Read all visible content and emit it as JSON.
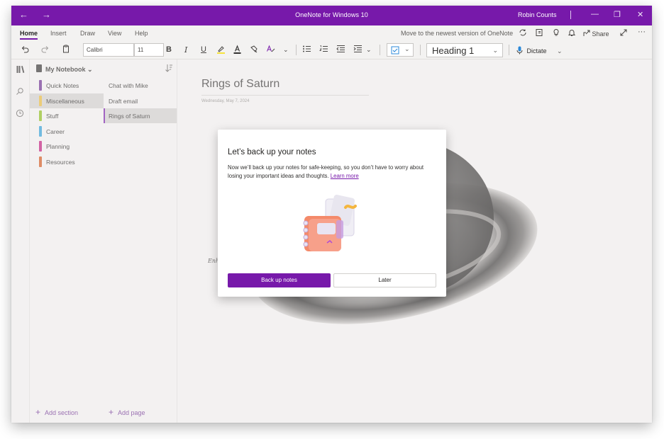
{
  "titlebar": {
    "title": "OneNote for Windows 10",
    "user": "Robin Counts",
    "back_glyph": "←",
    "forward_glyph": "→",
    "minimize_glyph": "—",
    "restore_glyph": "❐",
    "close_glyph": "✕"
  },
  "ribbon": {
    "tabs": [
      "Home",
      "Insert",
      "Draw",
      "View",
      "Help"
    ],
    "newest_version": "Move to the newest version of OneNote",
    "share": "Share",
    "more": "···"
  },
  "toolbar": {
    "font": "Calibri",
    "size": "11",
    "bold": "B",
    "italic": "I",
    "underline": "U",
    "style": "Heading 1",
    "dictate": "Dictate"
  },
  "notebook": {
    "name": "My Notebook",
    "sections": [
      {
        "label": "Quick Notes",
        "color": "#6b2c91"
      },
      {
        "label": "Miscellaneous",
        "color": "#e8b83a"
      },
      {
        "label": "Stuff",
        "color": "#8cbd18"
      },
      {
        "label": "Career",
        "color": "#2d9fd8"
      },
      {
        "label": "Planning",
        "color": "#c0187c"
      },
      {
        "label": "Resources",
        "color": "#d3571d"
      }
    ],
    "pages": [
      {
        "label": "Chat with Mike"
      },
      {
        "label": "Draft email"
      },
      {
        "label": "Rings of Saturn"
      }
    ],
    "add_section": "Add section",
    "add_page": "Add page"
  },
  "page": {
    "title": "Rings of Saturn",
    "date": "Wednesday, May 7, 2024",
    "handnote": "Enh"
  },
  "dialog": {
    "title": "Let’s back up your notes",
    "body": "Now we’ll back up your notes for safe-keeping, so you don’t have to worry about losing your important ideas and thoughts.",
    "learn_more": "Learn more",
    "primary": "Back up notes",
    "secondary": "Later"
  },
  "colors": {
    "accent": "#7719aa"
  }
}
